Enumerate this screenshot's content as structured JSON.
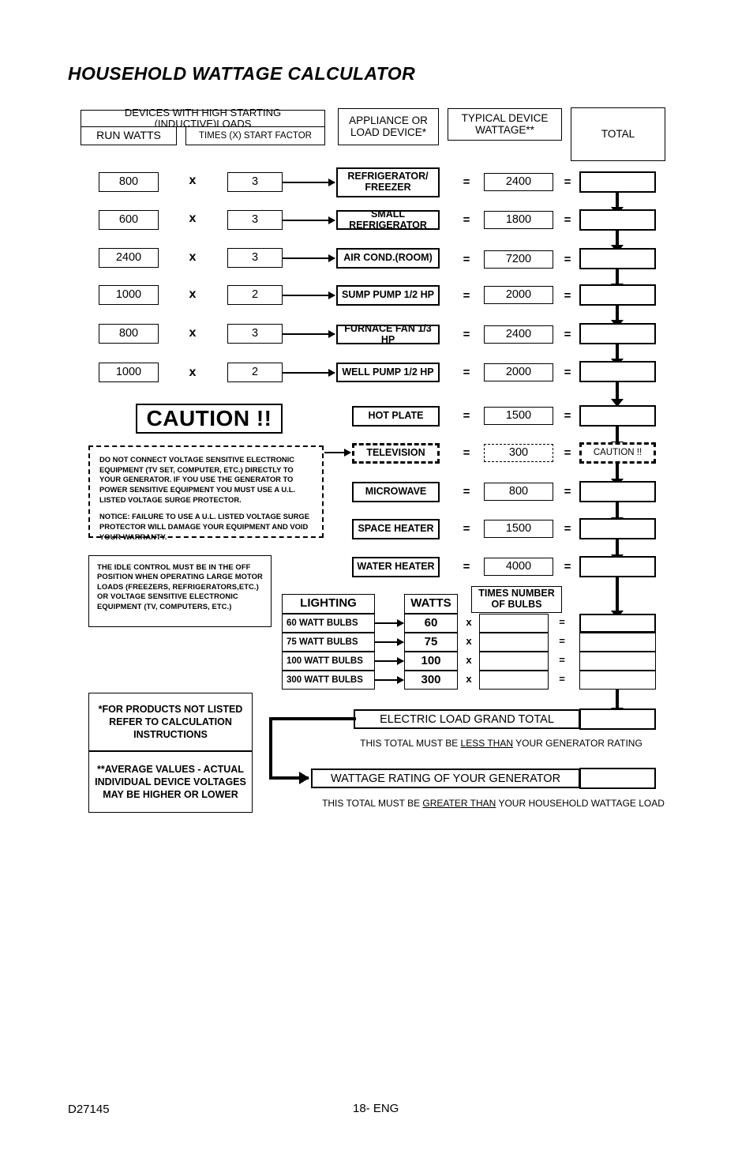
{
  "document": {
    "title": "HOUSEHOLD WATTAGE CALCULATOR",
    "footer_code": "D27145",
    "footer_page": "18- ENG"
  },
  "headers": {
    "devices_high_starting": "DEVICES WITH HIGH STARTING (INDUCTIVE)LOADS",
    "run_watts": "RUN WATTS",
    "times_start_factor": "TIMES (X) START FACTOR",
    "appliance_or_load_device": "APPLIANCE OR LOAD DEVICE*",
    "typical_device_wattage": "TYPICAL DEVICE WATTAGE**",
    "total": "TOTAL"
  },
  "operators": {
    "multiply": "x",
    "equals": "=",
    "multiply_upper": "X"
  },
  "inductive_rows": [
    {
      "run_watts": "800",
      "start_factor": "3",
      "device": "REFRIGERATOR/ FREEZER",
      "device_line1": "REFRIGERATOR/",
      "device_line2": "FREEZER",
      "wattage": "2400",
      "total": ""
    },
    {
      "run_watts": "600",
      "start_factor": "3",
      "device": "SMALL REFRIGERATOR",
      "wattage": "1800",
      "total": ""
    },
    {
      "run_watts": "2400",
      "start_factor": "3",
      "device": "AIR COND.(ROOM)",
      "wattage": "7200",
      "total": ""
    },
    {
      "run_watts": "1000",
      "start_factor": "2",
      "device": "SUMP PUMP 1/2 HP",
      "wattage": "2000",
      "total": ""
    },
    {
      "run_watts": "800",
      "start_factor": "3",
      "device": "FURNACE FAN 1/3 HP",
      "wattage": "2400",
      "total": ""
    },
    {
      "run_watts": "1000",
      "start_factor": "2",
      "device": "WELL PUMP 1/2 HP",
      "wattage": "2000",
      "total": ""
    }
  ],
  "resistive_rows": [
    {
      "device": "HOT PLATE",
      "wattage": "1500",
      "total": "",
      "dashed": false
    },
    {
      "device": "TELEVISION",
      "wattage": "300",
      "total": "CAUTION !!",
      "dashed": true
    },
    {
      "device": "MICROWAVE",
      "wattage": "800",
      "total": "",
      "dashed": false
    },
    {
      "device": "SPACE HEATER",
      "wattage": "1500",
      "total": "",
      "dashed": false
    },
    {
      "device": "WATER HEATER",
      "wattage": "4000",
      "total": "",
      "dashed": false
    }
  ],
  "caution": {
    "banner": "CAUTION !!",
    "body_paragraph_1": "DO NOT CONNECT VOLTAGE SENSITIVE ELECTRONIC EQUIPMENT (TV SET, COMPUTER, ETC.) DIRECTLY TO YOUR GENERATOR. IF YOU USE THE GENERATOR TO POWER SENSITIVE EQUIPMENT YOU MUST USE A U.L. LISTED VOLTAGE SURGE PROTECTOR.",
    "body_paragraph_2": "NOTICE:  FAILURE TO USE A U.L. LISTED VOLTAGE SURGE PROTECTOR WILL DAMAGE YOUR EQUIPMENT AND VOID YOUR WARRANTY.",
    "total_cell": "CAUTION !!"
  },
  "idle_control_note": "THE IDLE CONTROL MUST BE IN THE OFF POSITION WHEN OPERATING LARGE MOTOR LOADS (FREEZERS, REFRIGERATORS,ETC.) OR VOLTAGE SENSITIVE ELECTRONIC EQUIPMENT (TV, COMPUTERS, ETC.)",
  "lighting": {
    "header_lighting": "LIGHTING",
    "header_watts": "WATTS",
    "header_times_bulbs": "TIMES NUMBER OF BULBS",
    "rows": [
      {
        "name": "60 WATT BULBS",
        "watts": "60",
        "bulbs": "",
        "total": ""
      },
      {
        "name": "75 WATT BULBS",
        "watts": "75",
        "bulbs": "",
        "total": ""
      },
      {
        "name": "100 WATT BULBS",
        "watts": "100",
        "bulbs": "",
        "total": ""
      },
      {
        "name": "300 WATT BULBS",
        "watts": "300",
        "bulbs": "",
        "total": ""
      }
    ]
  },
  "footnotes": {
    "single_star": "*FOR PRODUCTS NOT LISTED REFER TO CALCULATION INSTRUCTIONS",
    "double_star": "**AVERAGE VALUES - ACTUAL INDIVIDUAL DEVICE VOLTAGES MAY BE HIGHER OR LOWER"
  },
  "totals_section": {
    "grand_total_label": "ELECTRIC LOAD GRAND TOTAL",
    "grand_total_value": "",
    "grand_total_caption_pre": "THIS TOTAL MUST BE ",
    "grand_total_caption_em": "LESS THAN",
    "grand_total_caption_post": " YOUR GENERATOR RATING",
    "generator_label": "WATTAGE RATING OF YOUR GENERATOR",
    "generator_value": "",
    "generator_caption_pre": "THIS TOTAL MUST BE ",
    "generator_caption_em": "GREATER THAN",
    "generator_caption_post": " YOUR HOUSEHOLD WATTAGE LOAD"
  },
  "colors": {
    "ink": "#000000",
    "paper": "#ffffff"
  }
}
